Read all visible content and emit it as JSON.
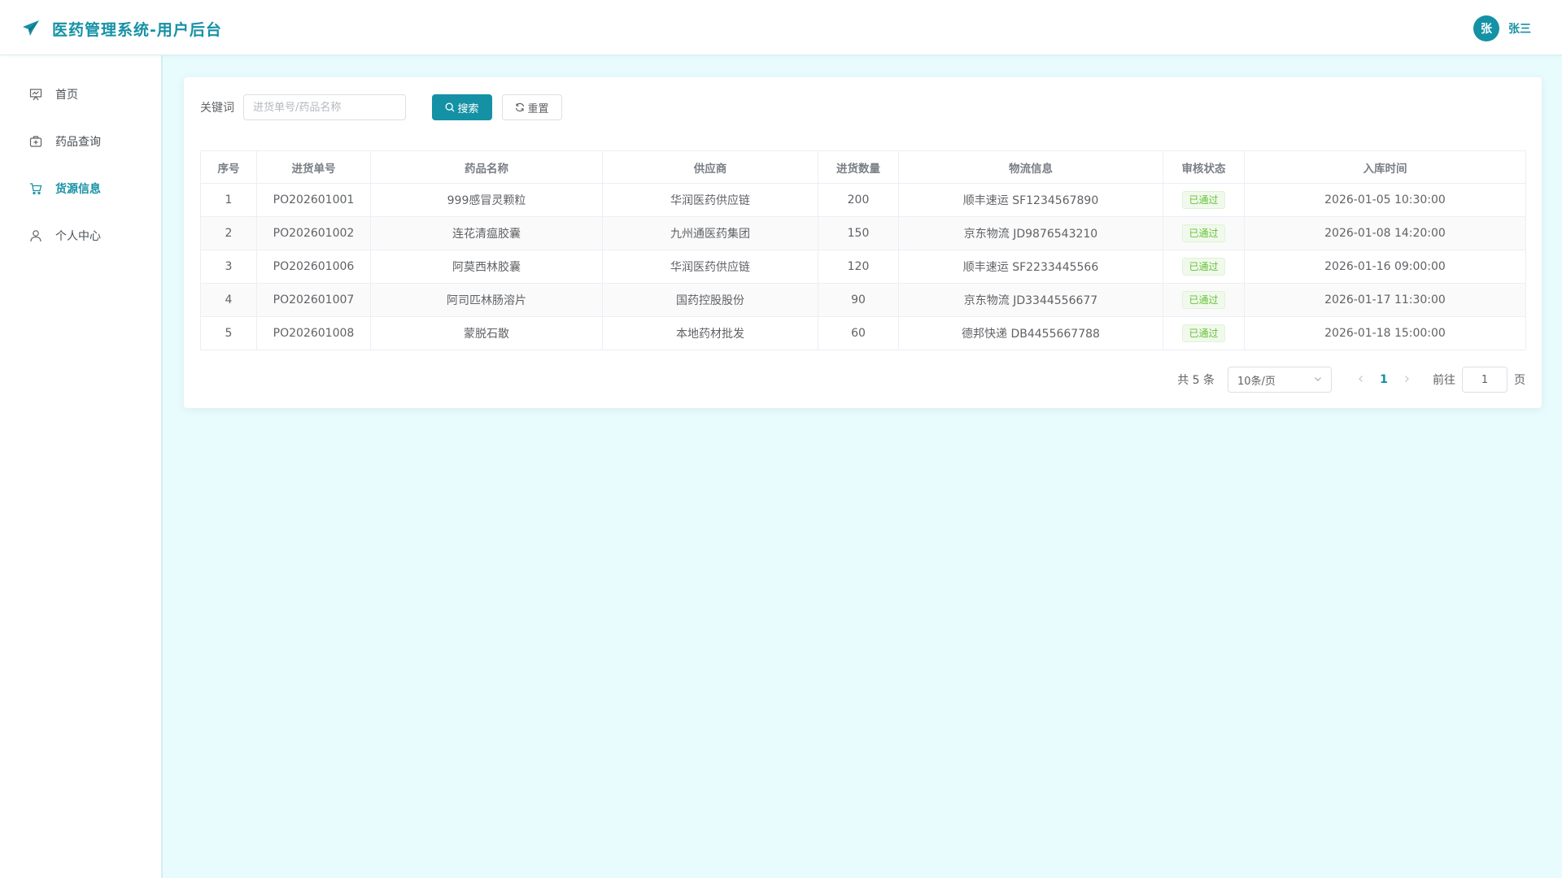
{
  "app": {
    "title": "医药管理系统-用户后台",
    "logo_icon": "paper-plane-icon",
    "brand_color": "#1591a5"
  },
  "user": {
    "avatar_text": "张",
    "name": "张三"
  },
  "sidebar": {
    "items": [
      {
        "label": "首页",
        "icon": "presentation-board-icon",
        "active": false
      },
      {
        "label": "药品查询",
        "icon": "medicine-box-icon",
        "active": false
      },
      {
        "label": "货源信息",
        "icon": "shopping-cart-icon",
        "active": true
      },
      {
        "label": "个人中心",
        "icon": "user-icon",
        "active": false
      }
    ]
  },
  "search": {
    "label": "关键词",
    "placeholder": "进货单号/药品名称",
    "value": "",
    "search_label": "搜索",
    "reset_label": "重置"
  },
  "table": {
    "columns": [
      "序号",
      "进货单号",
      "药品名称",
      "供应商",
      "进货数量",
      "物流信息",
      "审核状态",
      "入库时间"
    ],
    "rows": [
      {
        "index": "1",
        "order_no": "PO202601001",
        "drug": "999感冒灵颗粒",
        "supplier": "华润医药供应链",
        "qty": "200",
        "logistics": "顺丰速运 SF1234567890",
        "status": "已通过",
        "time": "2026-01-05 10:30:00"
      },
      {
        "index": "2",
        "order_no": "PO202601002",
        "drug": "连花清瘟胶囊",
        "supplier": "九州通医药集团",
        "qty": "150",
        "logistics": "京东物流 JD9876543210",
        "status": "已通过",
        "time": "2026-01-08 14:20:00"
      },
      {
        "index": "3",
        "order_no": "PO202601006",
        "drug": "阿莫西林胶囊",
        "supplier": "华润医药供应链",
        "qty": "120",
        "logistics": "顺丰速运 SF2233445566",
        "status": "已通过",
        "time": "2026-01-16 09:00:00"
      },
      {
        "index": "4",
        "order_no": "PO202601007",
        "drug": "阿司匹林肠溶片",
        "supplier": "国药控股股份",
        "qty": "90",
        "logistics": "京东物流 JD3344556677",
        "status": "已通过",
        "time": "2026-01-17 11:30:00"
      },
      {
        "index": "5",
        "order_no": "PO202601008",
        "drug": "蒙脱石散",
        "supplier": "本地药材批发",
        "qty": "60",
        "logistics": "德邦快递 DB4455667788",
        "status": "已通过",
        "time": "2026-01-18 15:00:00"
      }
    ]
  },
  "pagination": {
    "total_text": "共 5 条",
    "page_size": "10条/页",
    "current_page": "1",
    "goto_label": "前往",
    "goto_value": "1",
    "page_unit": "页"
  }
}
